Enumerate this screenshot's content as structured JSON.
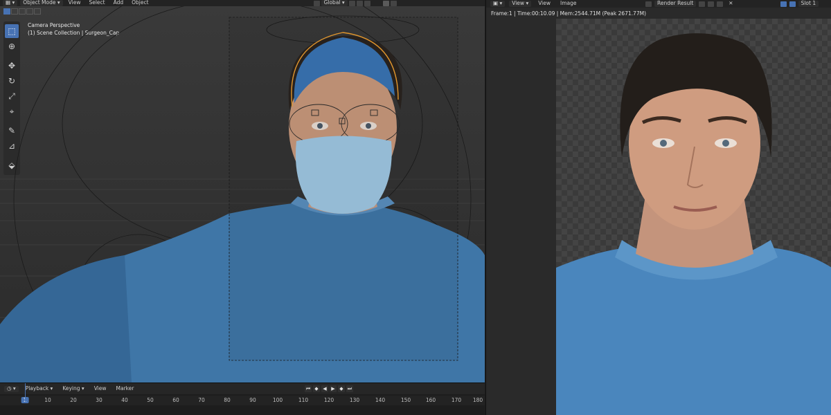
{
  "viewport": {
    "header": {
      "mode_label": "Object Mode",
      "menu": [
        "View",
        "Select",
        "Add",
        "Object"
      ],
      "transform_orientation": "Global"
    },
    "info": {
      "line1": "Camera Perspective",
      "line2": "(1) Scene Collection | Surgeon_Cap"
    },
    "tools": [
      "select-box",
      "cursor",
      "move",
      "rotate",
      "scale",
      "transform",
      "annotate",
      "measure",
      "add-cube"
    ],
    "icons": {
      "select-box": "⬚",
      "cursor": "⊕",
      "move": "✥",
      "rotate": "↻",
      "scale": "⤢",
      "transform": "⌖",
      "annotate": "✎",
      "measure": "⊿",
      "add-cube": "⬙"
    }
  },
  "timeline": {
    "menu": [
      "Playback",
      "Keying",
      "View",
      "Marker"
    ],
    "transport_icons": [
      "⏮",
      "◆",
      "◀",
      "▶",
      "◆",
      "⏭"
    ],
    "current_frame": "1",
    "ticks": [
      "10",
      "20",
      "30",
      "40",
      "50",
      "60",
      "70",
      "80",
      "90",
      "100",
      "110",
      "120",
      "130",
      "140",
      "150",
      "160",
      "170",
      "180"
    ]
  },
  "image_editor": {
    "menu": [
      "View",
      "View",
      "Image"
    ],
    "image_name": "Render Result",
    "slot": "Slot 1",
    "status": "Frame:1 | Time:00:10.09 | Mem:2544.71M (Peak 2671.77M)"
  },
  "colors": {
    "accent": "#4772b3",
    "selection": "#f0a030",
    "scrubs": "#4f86b8"
  }
}
